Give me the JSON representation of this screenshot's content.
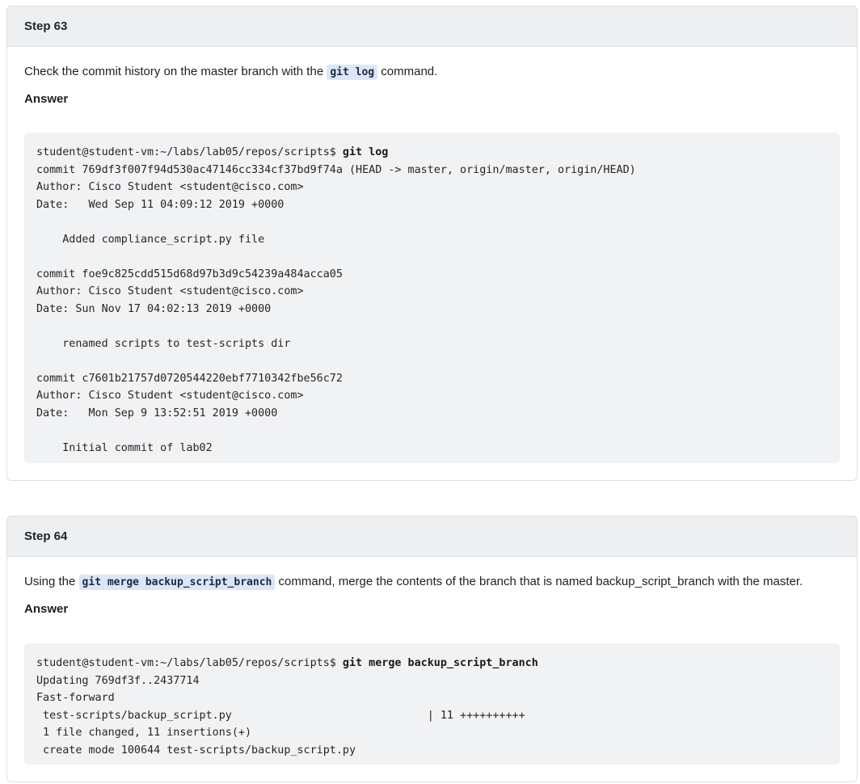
{
  "steps": [
    {
      "title": "Step 63",
      "instruction_before": "Check the commit history on the master branch with the ",
      "instruction_code": "git log",
      "instruction_after": " command.",
      "answer_label": "Answer",
      "terminal": {
        "prompt": "student@student-vm:~/labs/lab05/repos/scripts$ ",
        "command": "git log",
        "output": [
          "commit 769df3f007f94d530ac47146cc334cf37bd9f74a (HEAD -> master, origin/master, origin/HEAD)",
          "Author: Cisco Student <student@cisco.com>",
          "Date:   Wed Sep 11 04:09:12 2019 +0000",
          "",
          "    Added compliance_script.py file",
          "",
          "commit foe9c825cdd515d68d97b3d9c54239a484acca05",
          "Author: Cisco Student <student@cisco.com>",
          "Date: Sun Nov 17 04:02:13 2019 +0000",
          "",
          "    renamed scripts to test-scripts dir",
          "",
          "commit c7601b21757d0720544220ebf7710342fbe56c72",
          "Author: Cisco Student <student@cisco.com>",
          "Date:   Mon Sep 9 13:52:51 2019 +0000",
          "",
          "    Initial commit of lab02"
        ]
      }
    },
    {
      "title": "Step 64",
      "instruction_before": "Using the ",
      "instruction_code": "git merge backup_script_branch",
      "instruction_after": " command, merge the contents of the branch that is named backup_script_branch with the master.",
      "answer_label": "Answer",
      "terminal": {
        "prompt": "student@student-vm:~/labs/lab05/repos/scripts$ ",
        "command": "git merge backup_script_branch",
        "output": [
          "Updating 769df3f..2437714",
          "Fast-forward",
          " test-scripts/backup_script.py                              | 11 ++++++++++",
          " 1 file changed, 11 insertions(+)",
          " create mode 100644 test-scripts/backup_script.py"
        ]
      }
    }
  ]
}
